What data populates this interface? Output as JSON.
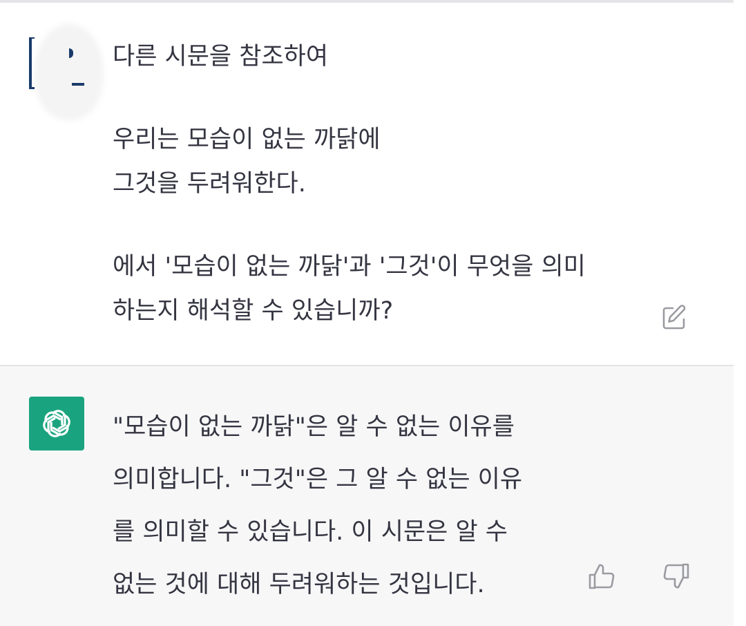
{
  "user_message": {
    "lines": [
      "다른 시문을 참조하여",
      "우리는 모습이 없는 까닭에",
      "그것을 두려워한다.",
      "에서 '모습이 없는 까닭'과 '그것'이 무엇을 의미",
      "하는지 해석할 수 있습니까?"
    ]
  },
  "assistant_message": {
    "lines": [
      "\"모습이 없는 까닭\"은 알 수 없는 이유를",
      "의미합니다. \"그것\"은 그 알 수 없는 이유",
      "를 의미할 수 있습니다. 이 시문은 알 수",
      "없는 것에 대해 두려워하는 것입니다."
    ]
  },
  "icons": {
    "edit": "edit-icon",
    "gpt": "chatgpt-logo",
    "thumb_up": "thumbs-up-icon",
    "thumb_down": "thumbs-down-icon"
  },
  "colors": {
    "gpt_logo_bg": "#1aa37f",
    "assistant_bg": "#f7f7f8",
    "text": "#343541",
    "icon": "#9a9ba1"
  }
}
